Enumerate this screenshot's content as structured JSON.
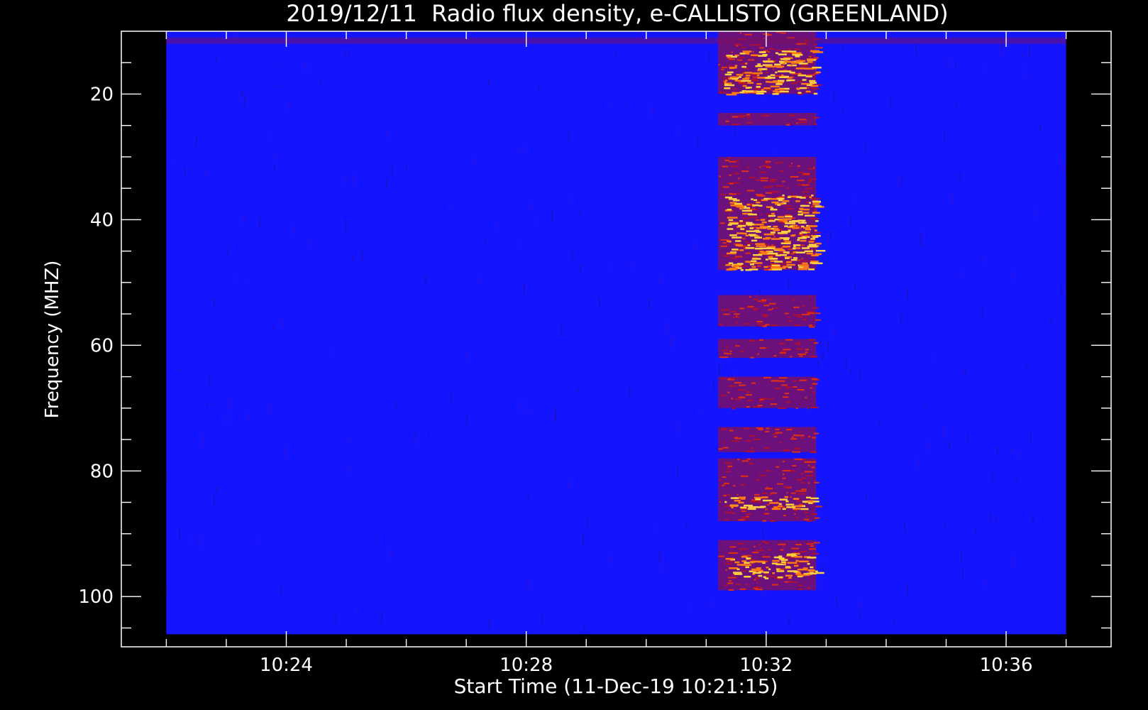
{
  "chart_data": {
    "type": "heatmap",
    "title": "2019/12/11  Radio flux density, e-CALLISTO (GREENLAND)",
    "xlabel": "Start Time (11-Dec-19 10:21:15)",
    "ylabel": "Frequency (MHZ)",
    "x_unit": "minutes",
    "xlim": [
      "10:21:15",
      "10:37:45"
    ],
    "data_x_range": [
      "10:22:00",
      "10:37:00"
    ],
    "ylim": [
      108,
      10
    ],
    "data_y_range": [
      106,
      10
    ],
    "y_axis_inverted": true,
    "x_ticks": [
      "10:24",
      "10:28",
      "10:32",
      "10:36"
    ],
    "y_ticks": [
      20,
      40,
      60,
      80,
      100
    ],
    "colormap": "blue-red-yellow",
    "background_color": "#1414ff",
    "axes_color": "#ffffff",
    "figure_background": "#000000",
    "events": [
      {
        "name": "burst",
        "t_start": "10:31:12",
        "t_end": "10:32:50",
        "bands_MHz": [
          [
            10,
            20
          ],
          [
            23,
            25
          ],
          [
            30,
            48
          ],
          [
            52,
            57
          ],
          [
            59,
            62
          ],
          [
            65,
            70
          ],
          [
            73,
            77
          ],
          [
            78,
            88
          ],
          [
            91,
            99
          ]
        ],
        "bright_bands_MHz": [
          [
            13,
            20
          ],
          [
            36,
            48
          ],
          [
            84,
            86
          ],
          [
            93,
            97
          ]
        ]
      },
      {
        "name": "weak-line",
        "t_start": "10:22:00",
        "t_end": "10:37:00",
        "bands_MHz": [
          [
            11,
            12
          ]
        ]
      }
    ]
  }
}
